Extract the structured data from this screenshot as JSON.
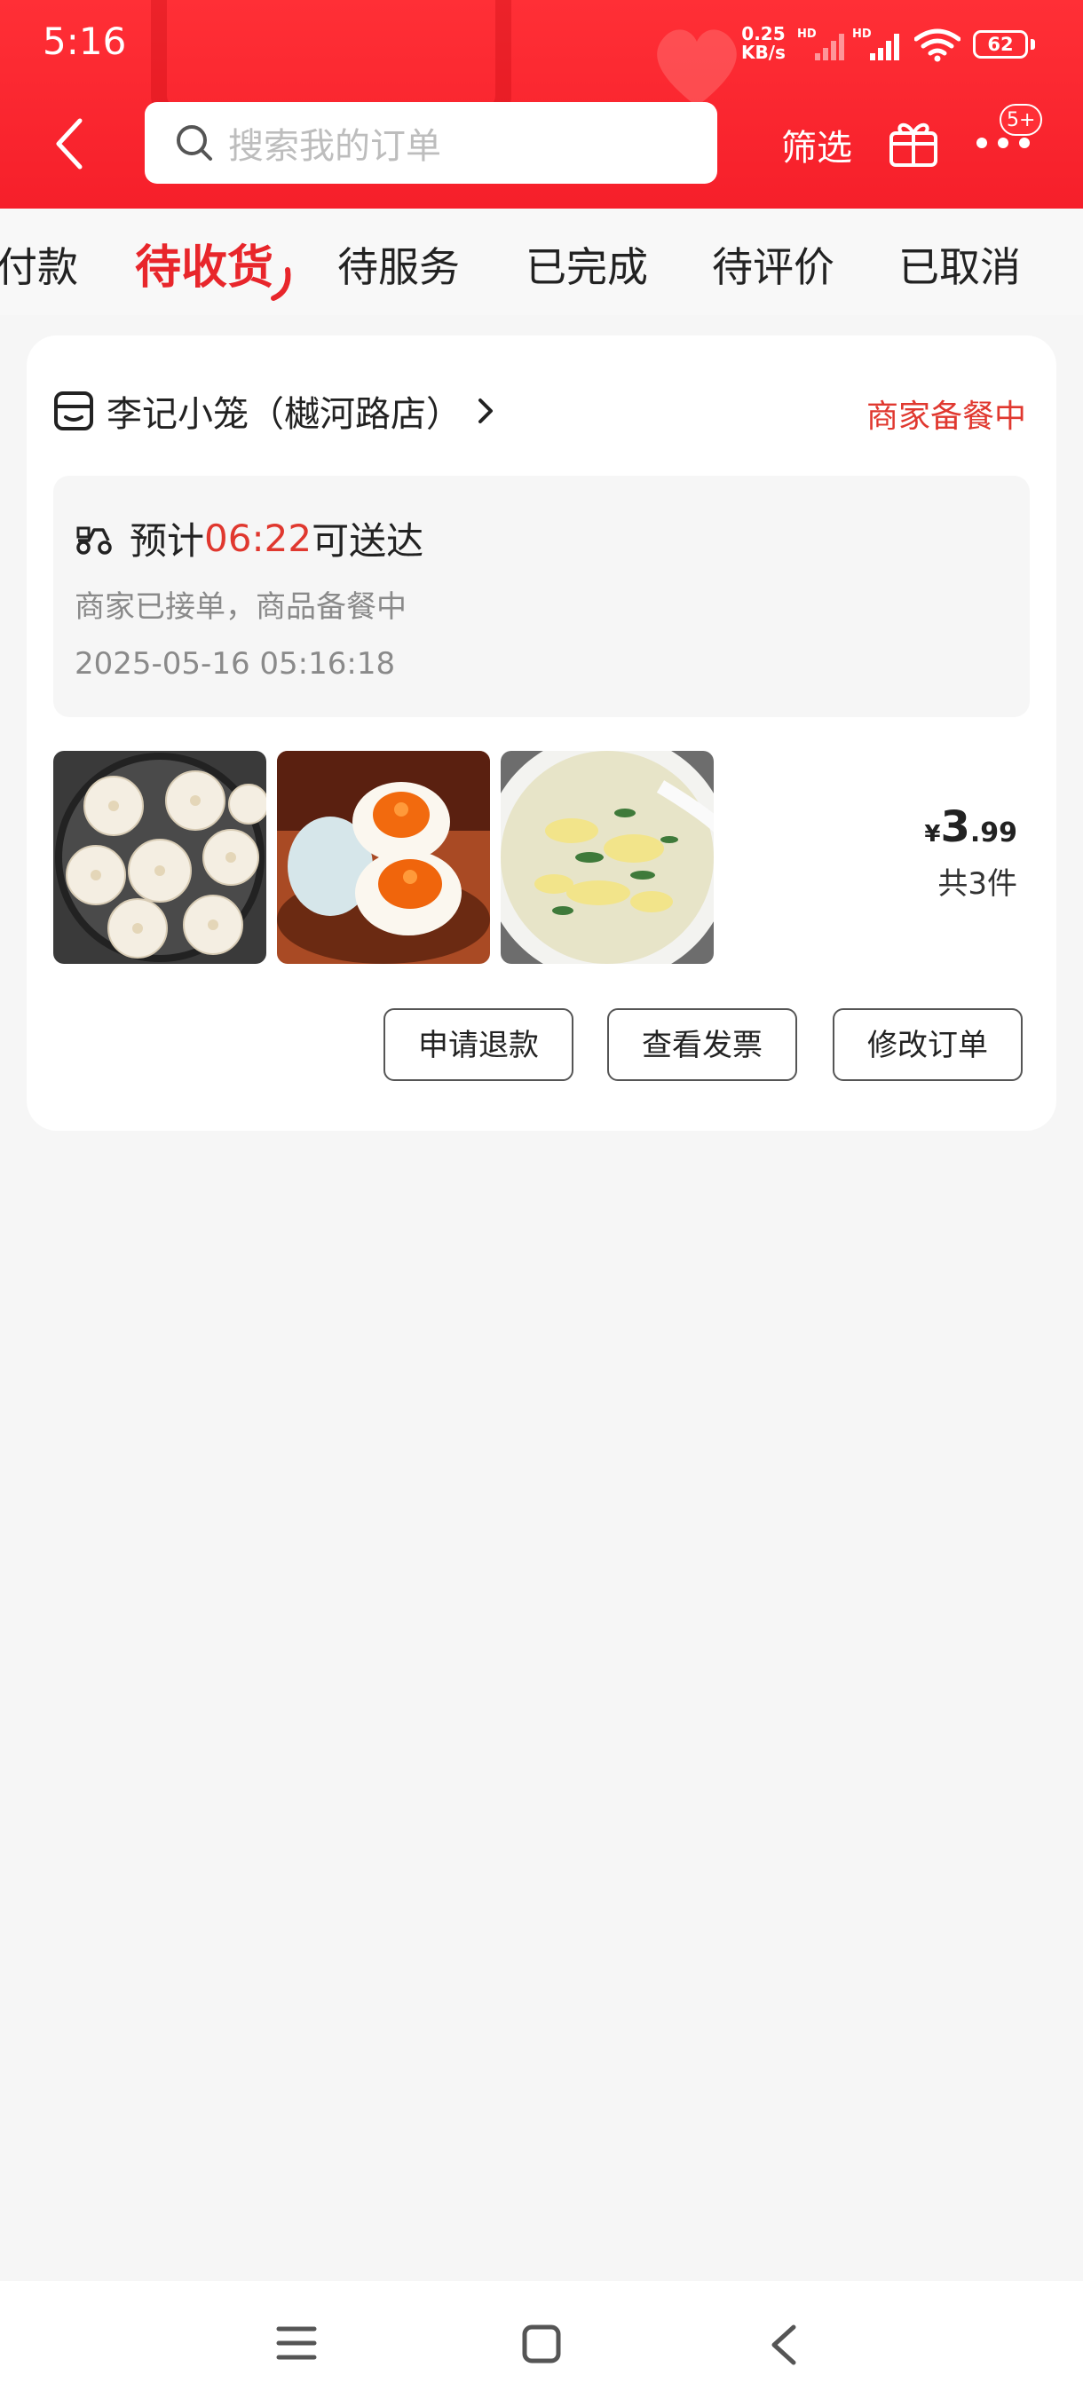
{
  "status_bar": {
    "time": "5:16",
    "net_speed_value": "0.25",
    "net_speed_unit": "KB/s",
    "battery": "62"
  },
  "header": {
    "search_placeholder": "搜索我的订单",
    "filter_label": "筛选",
    "more_badge": "5+",
    "brand_color": "#f61f2a"
  },
  "tabs": [
    {
      "label": "付款"
    },
    {
      "label": "待收货"
    },
    {
      "label": "待服务"
    },
    {
      "label": "已完成"
    },
    {
      "label": "待评价"
    },
    {
      "label": "已取消"
    }
  ],
  "order": {
    "shop_name": "李记小笼（樾河路店）",
    "status": "商家备餐中",
    "eta_prefix": "预计",
    "eta_time": "06:22",
    "eta_suffix": "可送达",
    "sub_status": "商家已接单，商品备餐中",
    "timestamp": "2025-05-16 05:16:18",
    "items": [
      {
        "icon": "steamed-buns-photo"
      },
      {
        "icon": "salted-duck-egg-photo"
      },
      {
        "icon": "egg-drop-soup-photo"
      }
    ],
    "price_currency": "¥",
    "price_integer": "3",
    "price_decimal": ".99",
    "item_count": "共3件",
    "actions": {
      "refund": "申请退款",
      "invoice": "查看发票",
      "modify": "修改订单"
    }
  },
  "accent_color": "#e0382f"
}
